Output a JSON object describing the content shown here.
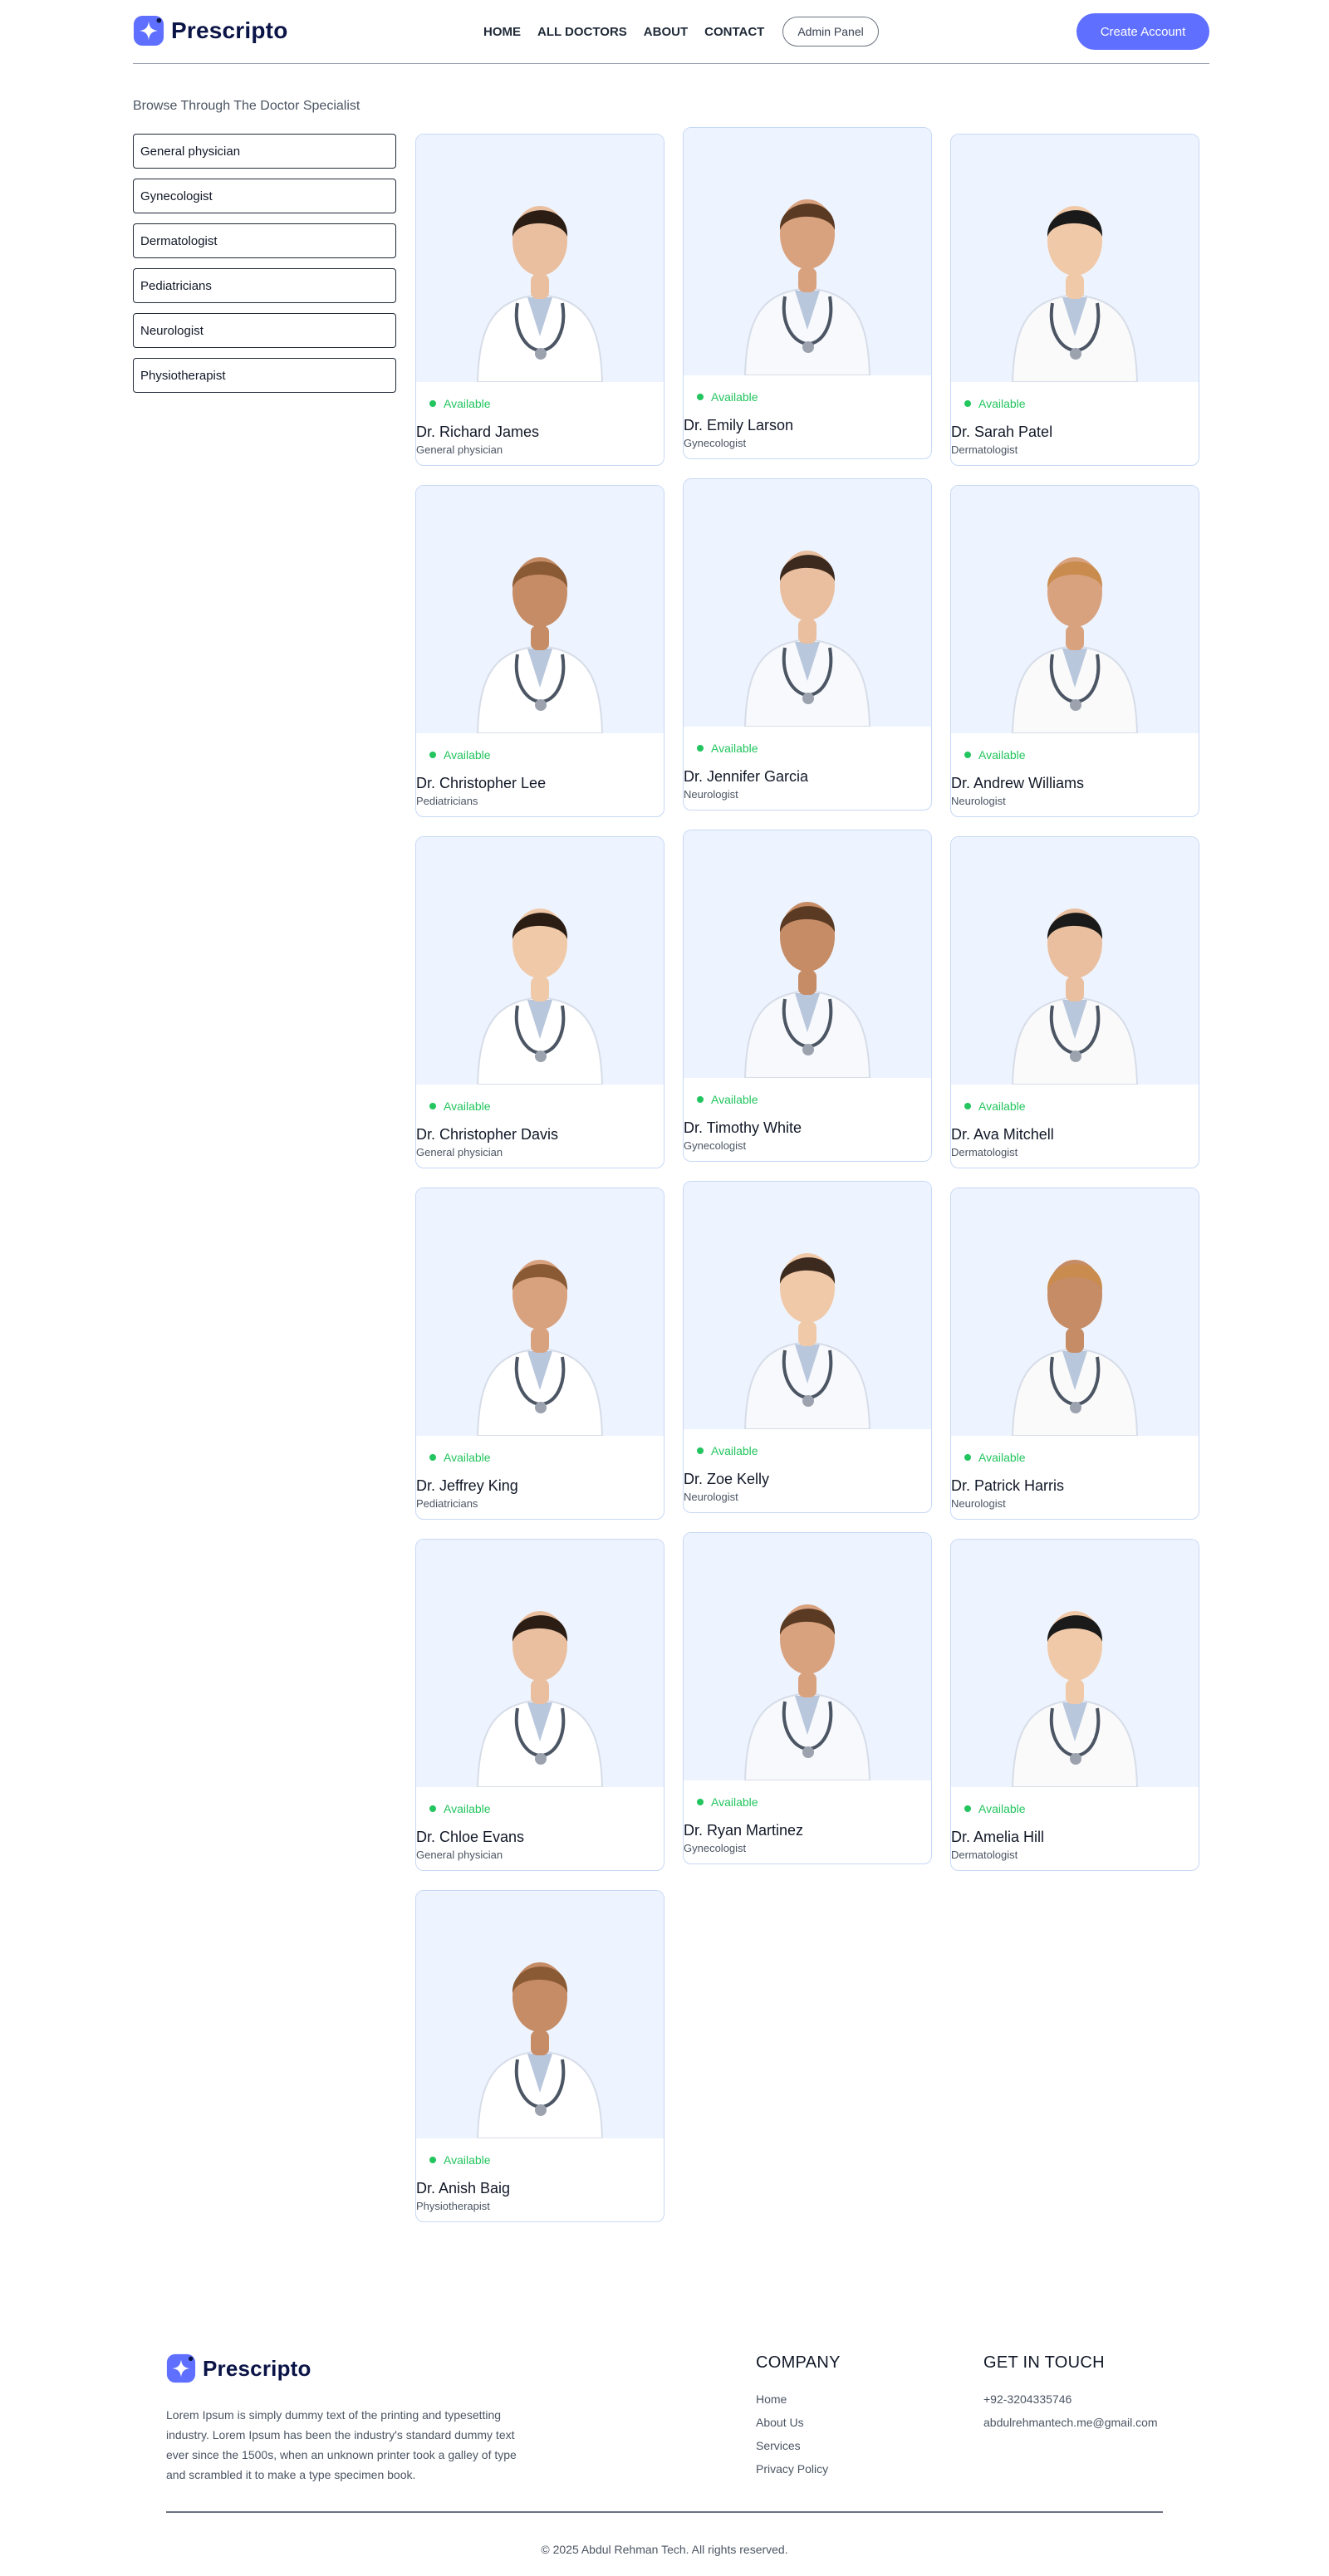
{
  "brand": {
    "name": "Prescripto",
    "accent": "#5f6fff"
  },
  "nav": {
    "items": [
      "HOME",
      "ALL DOCTORS",
      "ABOUT",
      "CONTACT"
    ],
    "admin_label": "Admin Panel",
    "create_label": "Create Account"
  },
  "sidebar": {
    "title": "Browse Through The Doctor Specialist",
    "items": [
      "General physician",
      "Gynecologist",
      "Dermatologist",
      "Pediatricians",
      "Neurologist",
      "Physiotherapist"
    ]
  },
  "doctors": [
    {
      "name": "Dr. Richard James",
      "speciality": "General physician",
      "status": "Available"
    },
    {
      "name": "Dr. Emily Larson",
      "speciality": "Gynecologist",
      "status": "Available"
    },
    {
      "name": "Dr. Sarah Patel",
      "speciality": "Dermatologist",
      "status": "Available"
    },
    {
      "name": "Dr. Christopher Lee",
      "speciality": "Pediatricians",
      "status": "Available"
    },
    {
      "name": "Dr. Jennifer Garcia",
      "speciality": "Neurologist",
      "status": "Available"
    },
    {
      "name": "Dr. Andrew Williams",
      "speciality": "Neurologist",
      "status": "Available"
    },
    {
      "name": "Dr. Christopher Davis",
      "speciality": "General physician",
      "status": "Available"
    },
    {
      "name": "Dr. Timothy White",
      "speciality": "Gynecologist",
      "status": "Available"
    },
    {
      "name": "Dr. Ava Mitchell",
      "speciality": "Dermatologist",
      "status": "Available"
    },
    {
      "name": "Dr. Jeffrey King",
      "speciality": "Pediatricians",
      "status": "Available"
    },
    {
      "name": "Dr. Zoe Kelly",
      "speciality": "Neurologist",
      "status": "Available"
    },
    {
      "name": "Dr. Patrick Harris",
      "speciality": "Neurologist",
      "status": "Available"
    },
    {
      "name": "Dr. Chloe Evans",
      "speciality": "General physician",
      "status": "Available"
    },
    {
      "name": "Dr. Ryan Martinez",
      "speciality": "Gynecologist",
      "status": "Available"
    },
    {
      "name": "Dr. Amelia Hill",
      "speciality": "Dermatologist",
      "status": "Available"
    },
    {
      "name": "Dr. Anish Baig",
      "speciality": "Physiotherapist",
      "status": "Available"
    }
  ],
  "footer": {
    "description": "Lorem Ipsum is simply dummy text of the printing and typesetting industry. Lorem Ipsum has been the industry's standard dummy text ever since the 1500s, when an unknown printer took a galley of type and scrambled it to make a type specimen book.",
    "company_title": "COMPANY",
    "company_links": [
      "Home",
      "About Us",
      "Services",
      "Privacy Policy"
    ],
    "contact_title": "GET IN TOUCH",
    "phone": "+92-3204335746",
    "email": "abdulrehmantech.me@gmail.com",
    "copyright": "© 2025 Abdul Rehman Tech. All rights reserved."
  }
}
